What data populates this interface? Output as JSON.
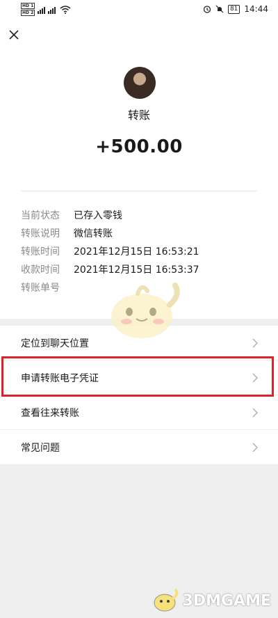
{
  "status_bar": {
    "sim1": "HD 1",
    "sim2": "HD 2",
    "net1": "5G",
    "net2": "4G",
    "battery": "81",
    "time": "14:44"
  },
  "header": {
    "close_icon": "close-icon"
  },
  "transfer": {
    "label": "转账",
    "amount": "+500.00"
  },
  "details": [
    {
      "key": "当前状态",
      "value": "已存入零钱"
    },
    {
      "key": "转账说明",
      "value": "微信转账"
    },
    {
      "key": "转账时间",
      "value": "2021年12月15日 16:53:21"
    },
    {
      "key": "收款时间",
      "value": "2021年12月15日 16:53:37"
    },
    {
      "key": "转账单号",
      "value": ""
    }
  ],
  "menu": [
    {
      "label": "定位到聊天位置"
    },
    {
      "label": "申请转账电子凭证"
    },
    {
      "label": "查看往来转账"
    },
    {
      "label": "常见问题"
    }
  ],
  "watermark": "3DMGAME",
  "colors": {
    "highlight": "#d9232d",
    "background": "#efefef"
  }
}
